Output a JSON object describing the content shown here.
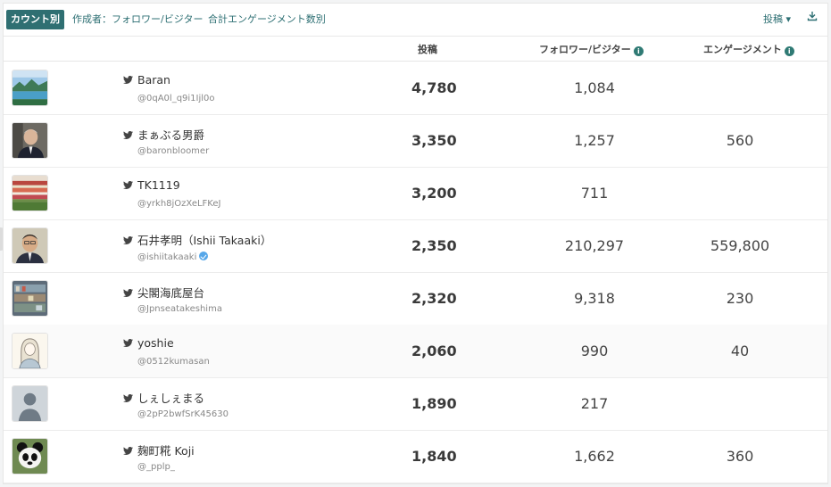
{
  "tabs": [
    {
      "label": "カウント別",
      "active": true
    },
    {
      "label": "作成者：フォロワー/ビジター",
      "active": false
    },
    {
      "label": "合計エンゲージメント数別",
      "active": false
    }
  ],
  "toolbar": {
    "posts_dropdown": "投稿 ▾",
    "download_icon": "download-icon"
  },
  "columns": {
    "posts": "投稿",
    "followers": "フォロワー/ビジター",
    "engagement": "エンゲージメント"
  },
  "rows": [
    {
      "name": "Baran",
      "handle": "@0qA0l_q9i1Ijl0o",
      "posts": "4,780",
      "followers": "1,084",
      "engagement": "",
      "verified": false,
      "avatar": "landscape-lake"
    },
    {
      "name": "まぁぶる男爵",
      "handle": "@baronbloomer",
      "posts": "3,350",
      "followers": "1,257",
      "engagement": "560",
      "verified": false,
      "avatar": "man-portrait"
    },
    {
      "name": "TK1119",
      "handle": "@yrkh8jOzXeLFKeJ",
      "posts": "3,200",
      "followers": "711",
      "engagement": "",
      "verified": false,
      "avatar": "flower-field"
    },
    {
      "name": "石井孝明（Ishii Takaaki）",
      "handle": "@ishiitakaaki",
      "posts": "2,350",
      "followers": "210,297",
      "engagement": "559,800",
      "verified": true,
      "avatar": "man-portrait-2"
    },
    {
      "name": "尖閣海底屋台",
      "handle": "@Jpnseatakeshima",
      "posts": "2,320",
      "followers": "9,318",
      "engagement": "230",
      "verified": false,
      "avatar": "shop-shelves"
    },
    {
      "name": "yoshie",
      "handle": "@0512kumasan",
      "posts": "2,060",
      "followers": "990",
      "engagement": "40",
      "verified": false,
      "avatar": "illustration-person"
    },
    {
      "name": "しぇしぇまる",
      "handle": "@2pP2bwfSrK45630",
      "posts": "1,890",
      "followers": "217",
      "engagement": "",
      "verified": false,
      "avatar": "default-avatar"
    },
    {
      "name": "麹町糀 Koji",
      "handle": "@_pplp_",
      "posts": "1,840",
      "followers": "1,662",
      "engagement": "360",
      "verified": false,
      "avatar": "panda"
    }
  ],
  "colors": {
    "accent": "#2f6f72",
    "twitter_bird": "#444444",
    "verified": "#56a7e9"
  }
}
